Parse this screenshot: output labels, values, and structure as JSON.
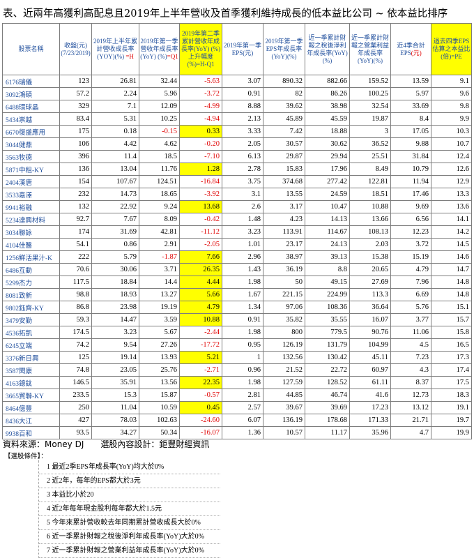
{
  "title": "表、近兩年高獲利高配息且2019年上半年營收及首季獲利維持成長的低本益比公司 ~ 依本益比排序",
  "headers": [
    {
      "text": "股票名稱"
    },
    {
      "text": "收盤(元) (7/23/2019)"
    },
    {
      "text": "2019年上半年累計營收成長率(YOY)(%) ",
      "red": "=H"
    },
    {
      "text": "2019年第一季營收年成長率(YoY) (%)",
      "red": "=Q1"
    },
    {
      "text": "2019年第二季累計營收年成長率(YoY) (%) 上升幅度(%)=H-Q1",
      "yellow": true
    },
    {
      "text": "2019年第一季EPS(元)"
    },
    {
      "text": "2019年第一季EPS年成長率(YoY)(%)"
    },
    {
      "text": "近一季累計財報之稅後淨利年成長率(YoY)(%)"
    },
    {
      "text": "近一季累計財報之營業利益年成長率(YoY)(%)"
    },
    {
      "text": "近4季合計EPS",
      "red": "(元)"
    },
    {
      "text": "過去四季EPS估算之本益比(倍)=PE",
      "yellow": true
    }
  ],
  "rows": [
    {
      "name": "6176瑞儀",
      "c": [
        "123",
        "26.81",
        "32.44",
        "-5.63",
        "3.07",
        "890.32",
        "882.66",
        "159.52",
        "13.59",
        "9.1"
      ],
      "neg": [
        3
      ],
      "hl": []
    },
    {
      "name": "3092鴻碩",
      "c": [
        "57.2",
        "2.24",
        "5.96",
        "-3.72",
        "0.91",
        "82",
        "86.26",
        "100.25",
        "5.97",
        "9.6"
      ],
      "neg": [
        3
      ],
      "hl": []
    },
    {
      "name": "6488環球晶",
      "c": [
        "329",
        "7.1",
        "12.09",
        "-4.99",
        "8.88",
        "39.62",
        "38.98",
        "32.54",
        "33.69",
        "9.8"
      ],
      "neg": [
        3
      ],
      "hl": []
    },
    {
      "name": "5434崇越",
      "c": [
        "83.4",
        "5.31",
        "10.25",
        "-4.94",
        "2.13",
        "45.89",
        "45.59",
        "19.87",
        "8.4",
        "9.9"
      ],
      "neg": [
        3
      ],
      "hl": []
    },
    {
      "name": "6670復盛應用",
      "c": [
        "175",
        "0.18",
        "-0.15",
        "0.33",
        "3.33",
        "7.42",
        "18.88",
        "3",
        "17.05",
        "10.3"
      ],
      "neg": [
        2
      ],
      "hl": [
        3
      ]
    },
    {
      "name": "3044健鼎",
      "c": [
        "106",
        "4.42",
        "4.62",
        "-0.20",
        "2.05",
        "30.57",
        "30.62",
        "36.52",
        "9.88",
        "10.7"
      ],
      "neg": [
        3
      ],
      "hl": []
    },
    {
      "name": "3563牧德",
      "c": [
        "396",
        "11.4",
        "18.5",
        "-7.10",
        "6.13",
        "29.87",
        "29.94",
        "25.51",
        "31.84",
        "12.4"
      ],
      "neg": [
        3
      ],
      "hl": []
    },
    {
      "name": "5871中租-KY",
      "c": [
        "136",
        "13.04",
        "11.76",
        "1.28",
        "2.78",
        "15.83",
        "17.96",
        "8.49",
        "10.79",
        "12.6"
      ],
      "neg": [],
      "hl": [
        3
      ]
    },
    {
      "name": "2404漢唐",
      "c": [
        "154",
        "107.67",
        "124.51",
        "-16.84",
        "3.75",
        "374.68",
        "277.42",
        "122.81",
        "11.94",
        "12.9"
      ],
      "neg": [
        3
      ],
      "hl": []
    },
    {
      "name": "3533嘉澤",
      "c": [
        "232",
        "14.73",
        "18.65",
        "-3.92",
        "3.1",
        "13.55",
        "24.59",
        "18.51",
        "17.46",
        "13.3"
      ],
      "neg": [
        3
      ],
      "hl": []
    },
    {
      "name": "9941裕融",
      "c": [
        "132",
        "22.92",
        "9.24",
        "13.68",
        "2.6",
        "3.17",
        "10.47",
        "10.88",
        "9.69",
        "13.6"
      ],
      "neg": [],
      "hl": [
        3
      ]
    },
    {
      "name": "5234達興材料",
      "c": [
        "92.7",
        "7.67",
        "8.09",
        "-0.42",
        "1.48",
        "4.23",
        "14.13",
        "13.66",
        "6.56",
        "14.1"
      ],
      "neg": [
        3
      ],
      "hl": []
    },
    {
      "name": "3034聯詠",
      "c": [
        "174",
        "31.69",
        "42.81",
        "-11.12",
        "3.23",
        "113.91",
        "114.67",
        "108.13",
        "12.23",
        "14.2"
      ],
      "neg": [
        3
      ],
      "hl": []
    },
    {
      "name": "4104佳醫",
      "c": [
        "54.1",
        "0.86",
        "2.91",
        "-2.05",
        "1.01",
        "23.17",
        "24.13",
        "2.03",
        "3.72",
        "14.5"
      ],
      "neg": [
        3
      ],
      "hl": []
    },
    {
      "name": "1256鮮活果汁-K",
      "c": [
        "222",
        "5.79",
        "-1.87",
        "7.66",
        "2.96",
        "38.97",
        "39.13",
        "15.38",
        "15.19",
        "14.6"
      ],
      "neg": [
        2
      ],
      "hl": [
        3
      ]
    },
    {
      "name": "6486互動",
      "c": [
        "70.6",
        "30.06",
        "3.71",
        "26.35",
        "1.43",
        "36.19",
        "8.8",
        "20.65",
        "4.79",
        "14.7"
      ],
      "neg": [],
      "hl": [
        3
      ]
    },
    {
      "name": "5299杰力",
      "c": [
        "117.5",
        "18.84",
        "14.4",
        "4.44",
        "1.98",
        "50",
        "49.15",
        "27.69",
        "7.96",
        "14.8"
      ],
      "neg": [],
      "hl": [
        3
      ]
    },
    {
      "name": "8081致新",
      "c": [
        "98.8",
        "18.93",
        "13.27",
        "5.66",
        "1.67",
        "221.15",
        "224.99",
        "113.3",
        "6.69",
        "14.8"
      ],
      "neg": [],
      "hl": [
        3
      ]
    },
    {
      "name": "9802鈺齊-KY",
      "c": [
        "86.8",
        "23.98",
        "19.19",
        "4.79",
        "1.34",
        "97.06",
        "108.36",
        "36.64",
        "5.76",
        "15.1"
      ],
      "neg": [],
      "hl": [
        3
      ]
    },
    {
      "name": "3479安勤",
      "c": [
        "59.3",
        "14.47",
        "3.59",
        "10.88",
        "0.91",
        "35.82",
        "35.55",
        "16.07",
        "3.77",
        "15.7"
      ],
      "neg": [],
      "hl": [
        3
      ]
    },
    {
      "name": "4536拓凱",
      "c": [
        "174.5",
        "3.23",
        "5.67",
        "-2.44",
        "1.98",
        "800",
        "779.5",
        "90.76",
        "11.06",
        "15.8"
      ],
      "neg": [
        3
      ],
      "hl": []
    },
    {
      "name": "6245立端",
      "c": [
        "74.2",
        "9.54",
        "27.26",
        "-17.72",
        "0.95",
        "126.19",
        "131.79",
        "104.99",
        "4.5",
        "16.5"
      ],
      "neg": [
        3
      ],
      "hl": []
    },
    {
      "name": "3376新日興",
      "c": [
        "125",
        "19.14",
        "13.93",
        "5.21",
        "1",
        "132.56",
        "130.42",
        "45.11",
        "7.23",
        "17.3"
      ],
      "neg": [],
      "hl": [
        3
      ]
    },
    {
      "name": "3587閎康",
      "c": [
        "74.8",
        "23.05",
        "25.76",
        "-2.71",
        "0.96",
        "21.52",
        "22.72",
        "60.97",
        "4.3",
        "17.4"
      ],
      "neg": [
        3
      ],
      "hl": []
    },
    {
      "name": "4163鐿鈦",
      "c": [
        "146.5",
        "35.91",
        "13.56",
        "22.35",
        "1.98",
        "127.59",
        "128.52",
        "61.11",
        "8.37",
        "17.5"
      ],
      "neg": [],
      "hl": [
        3
      ]
    },
    {
      "name": "3665貿聯-KY",
      "c": [
        "233.5",
        "15.3",
        "15.87",
        "-0.57",
        "2.81",
        "44.85",
        "46.74",
        "41.6",
        "12.73",
        "18.3"
      ],
      "neg": [
        3
      ],
      "hl": []
    },
    {
      "name": "8464億豐",
      "c": [
        "250",
        "11.04",
        "10.59",
        "0.45",
        "2.57",
        "39.67",
        "39.69",
        "17.23",
        "13.12",
        "19.1"
      ],
      "neg": [],
      "hl": [
        3
      ]
    },
    {
      "name": "8436大江",
      "c": [
        "427",
        "78.03",
        "102.63",
        "-24.60",
        "6.07",
        "136.19",
        "178.68",
        "171.33",
        "21.71",
        "19.7"
      ],
      "neg": [
        3
      ],
      "hl": []
    },
    {
      "name": "9938百和",
      "c": [
        "93.5",
        "34.27",
        "50.34",
        "-16.07",
        "1.36",
        "10.57",
        "11.17",
        "35.96",
        "4.7",
        "19.9"
      ],
      "neg": [
        3
      ],
      "hl": []
    }
  ],
  "source": "資料來源：Money DJ　　選股內容設計：鉅豐財經資訊",
  "conditions_label": "【選股條件】：",
  "conditions": [
    "1 最近2季EPS年成長率(YoY)均大於0%",
    "2 近2年，每年的EPS都大於3元",
    "3 本益比小於20",
    "4 近2年每年現金股利每年都大於1.5元",
    "5 今年來累計營收較去年同期累計營收成長大於0%",
    "6 近一季累計財報之稅後淨利年成長率(YoY)大於0%",
    "7 近一季累計財報之營業利益年成長率(YoY)大於0%"
  ]
}
